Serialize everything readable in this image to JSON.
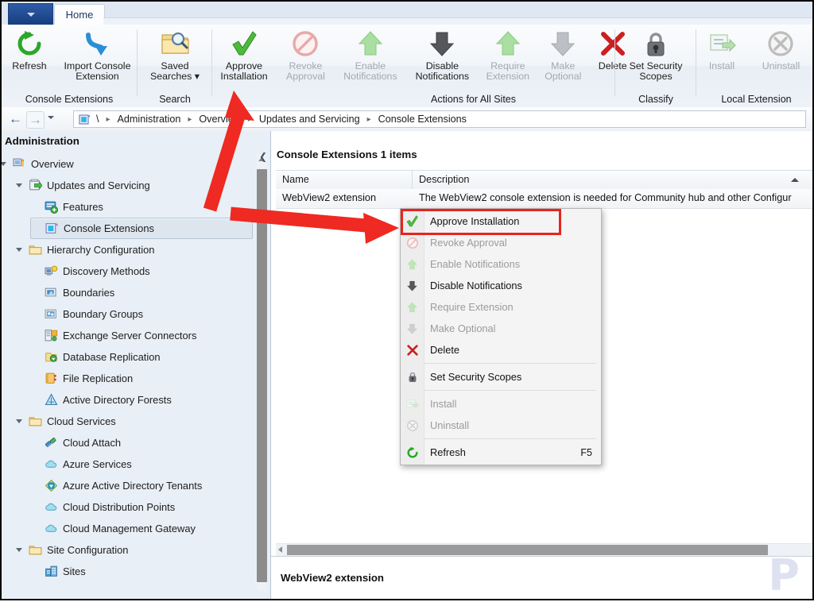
{
  "window": {
    "app_menu_icon": "app-menu-caret",
    "tabs": [
      {
        "label": "Home",
        "active": true
      }
    ]
  },
  "ribbon": {
    "groups": [
      {
        "name": "console-extensions",
        "label": "Console Extensions",
        "items": [
          {
            "label": "Refresh",
            "label2": "",
            "icon": "refresh-icon",
            "enabled": true
          },
          {
            "label": "Import Console",
            "label2": "Extension",
            "icon": "import-arrow-icon",
            "enabled": true
          }
        ]
      },
      {
        "name": "search",
        "label": "Search",
        "items": [
          {
            "label": "Saved",
            "label2": "Searches ▾",
            "icon": "saved-searches-icon",
            "enabled": true
          }
        ]
      },
      {
        "name": "actions-for-all-sites",
        "label": "Actions for All Sites",
        "items": [
          {
            "label": "Approve",
            "label2": "Installation",
            "icon": "green-check-icon",
            "enabled": true
          },
          {
            "label": "Revoke",
            "label2": "Approval",
            "icon": "revoke-prohibited-icon",
            "enabled": false
          },
          {
            "label": "Enable",
            "label2": "Notifications",
            "icon": "green-up-arrow-icon",
            "enabled": false
          },
          {
            "label": "Disable",
            "label2": "Notifications",
            "icon": "dark-down-arrow-icon",
            "enabled": true
          },
          {
            "label": "Require",
            "label2": "Extension",
            "icon": "green-up-arrow-icon",
            "enabled": false
          },
          {
            "label": "Make",
            "label2": "Optional",
            "icon": "gray-down-arrow-icon",
            "enabled": false
          },
          {
            "label": "Delete",
            "label2": "",
            "icon": "red-x-icon",
            "enabled": true
          }
        ]
      },
      {
        "name": "classify",
        "label": "Classify",
        "items": [
          {
            "label": "Set Security",
            "label2": "Scopes",
            "icon": "lock-icon",
            "enabled": true
          }
        ]
      },
      {
        "name": "local-extension",
        "label": "Local Extension",
        "items": [
          {
            "label": "Install",
            "label2": "",
            "icon": "install-icon",
            "enabled": false
          },
          {
            "label": "Uninstall",
            "label2": "",
            "icon": "uninstall-x-circle-icon",
            "enabled": false
          }
        ]
      }
    ]
  },
  "nav": {
    "back_icon": "back-arrow-icon",
    "forward_icon": "forward-arrow-icon",
    "history_icon": "chevron-down-icon",
    "root_icon": "console-extension-icon",
    "breadcrumb": [
      "\\",
      "Administration",
      "Overview",
      "Updates and Servicing",
      "Console Extensions"
    ]
  },
  "sidebar": {
    "title": "Administration",
    "collapse_icon": "collapse-pane-icon",
    "items": [
      {
        "label": "Overview",
        "icon": "overview-icon",
        "depth": 0,
        "twisty": "open",
        "selected": false
      },
      {
        "label": "Updates and Servicing",
        "icon": "updates-servicing-icon",
        "depth": 1,
        "twisty": "open",
        "selected": false
      },
      {
        "label": "Features",
        "icon": "features-icon",
        "depth": 2,
        "twisty": "none",
        "selected": false
      },
      {
        "label": "Console Extensions",
        "icon": "console-extension-icon",
        "depth": 2,
        "twisty": "none",
        "selected": true
      },
      {
        "label": "Hierarchy Configuration",
        "icon": "folder-icon",
        "depth": 1,
        "twisty": "open",
        "selected": false
      },
      {
        "label": "Discovery Methods",
        "icon": "discovery-methods-icon",
        "depth": 2,
        "twisty": "none",
        "selected": false
      },
      {
        "label": "Boundaries",
        "icon": "boundaries-icon",
        "depth": 2,
        "twisty": "none",
        "selected": false
      },
      {
        "label": "Boundary Groups",
        "icon": "boundary-groups-icon",
        "depth": 2,
        "twisty": "none",
        "selected": false
      },
      {
        "label": "Exchange Server Connectors",
        "icon": "exchange-connector-icon",
        "depth": 2,
        "twisty": "none",
        "selected": false
      },
      {
        "label": "Database Replication",
        "icon": "database-replication-icon",
        "depth": 2,
        "twisty": "none",
        "selected": false
      },
      {
        "label": "File Replication",
        "icon": "file-replication-icon",
        "depth": 2,
        "twisty": "none",
        "selected": false
      },
      {
        "label": "Active Directory Forests",
        "icon": "ad-forests-icon",
        "depth": 2,
        "twisty": "none",
        "selected": false
      },
      {
        "label": "Cloud Services",
        "icon": "folder-icon",
        "depth": 1,
        "twisty": "open",
        "selected": false
      },
      {
        "label": "Cloud Attach",
        "icon": "cloud-attach-icon",
        "depth": 2,
        "twisty": "none",
        "selected": false
      },
      {
        "label": "Azure Services",
        "icon": "cloud-icon",
        "depth": 2,
        "twisty": "none",
        "selected": false
      },
      {
        "label": "Azure Active Directory Tenants",
        "icon": "aad-tenants-icon",
        "depth": 2,
        "twisty": "none",
        "selected": false
      },
      {
        "label": "Cloud Distribution Points",
        "icon": "cloud-icon",
        "depth": 2,
        "twisty": "none",
        "selected": false
      },
      {
        "label": "Cloud Management Gateway",
        "icon": "cloud-icon",
        "depth": 2,
        "twisty": "none",
        "selected": false
      },
      {
        "label": "Site Configuration",
        "icon": "folder-icon",
        "depth": 1,
        "twisty": "open",
        "selected": false
      },
      {
        "label": "Sites",
        "icon": "sites-icon",
        "depth": 2,
        "twisty": "none",
        "selected": false
      }
    ]
  },
  "main": {
    "title": "Console Extensions 1 items",
    "columns": [
      "Name",
      "Description"
    ],
    "rows": [
      {
        "name": "WebView2 extension",
        "description": "The WebView2 console extension is needed for Community hub and other Configur"
      }
    ],
    "detail_title": "WebView2 extension",
    "watermark": "P"
  },
  "context_menu": {
    "highlighted": "Approve Installation",
    "items": [
      {
        "label": "Approve Installation",
        "icon": "green-check-icon",
        "enabled": true,
        "shortcut": "",
        "separator_after": false
      },
      {
        "label": "Revoke Approval",
        "icon": "revoke-prohibited-icon",
        "enabled": false,
        "shortcut": "",
        "separator_after": false
      },
      {
        "label": "Enable Notifications",
        "icon": "green-up-arrow-icon",
        "enabled": false,
        "shortcut": "",
        "separator_after": false
      },
      {
        "label": "Disable Notifications",
        "icon": "dark-down-arrow-icon",
        "enabled": true,
        "shortcut": "",
        "separator_after": false
      },
      {
        "label": "Require Extension",
        "icon": "green-up-arrow-icon",
        "enabled": false,
        "shortcut": "",
        "separator_after": false
      },
      {
        "label": "Make Optional",
        "icon": "gray-down-arrow-icon",
        "enabled": false,
        "shortcut": "",
        "separator_after": false
      },
      {
        "label": "Delete",
        "icon": "red-x-icon",
        "enabled": true,
        "shortcut": "",
        "separator_after": true
      },
      {
        "label": "Set Security Scopes",
        "icon": "lock-icon",
        "enabled": true,
        "shortcut": "",
        "separator_after": true
      },
      {
        "label": "Install",
        "icon": "install-icon",
        "enabled": false,
        "shortcut": "",
        "separator_after": false
      },
      {
        "label": "Uninstall",
        "icon": "uninstall-x-circle-icon",
        "enabled": false,
        "shortcut": "",
        "separator_after": true
      },
      {
        "label": "Refresh",
        "icon": "refresh-icon",
        "enabled": true,
        "shortcut": "F5",
        "separator_after": false
      }
    ]
  },
  "annotations": {
    "highlight_color": "#e8231f",
    "arrows": [
      {
        "name": "arrow-to-ribbon-approve-installation"
      },
      {
        "name": "arrow-to-context-menu-approve-installation"
      }
    ]
  }
}
